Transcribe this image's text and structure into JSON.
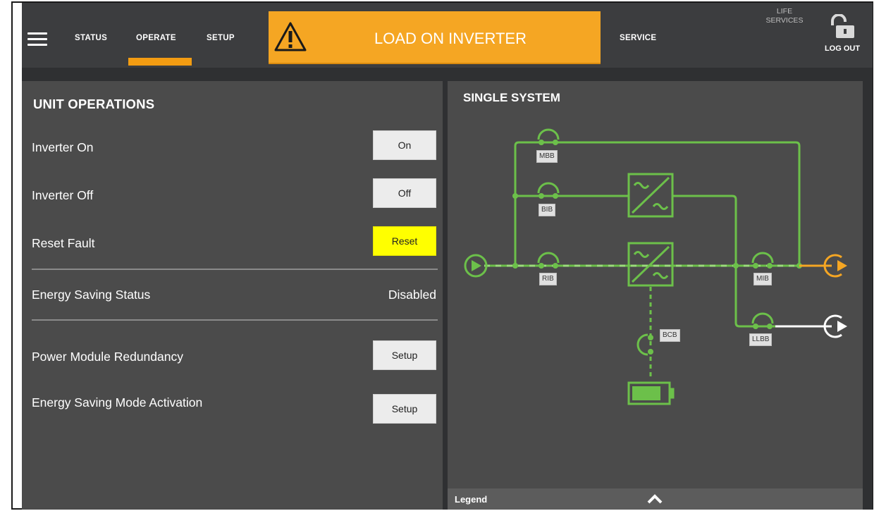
{
  "nav": {
    "tabs": [
      {
        "label": "STATUS"
      },
      {
        "label": "OPERATE"
      },
      {
        "label": "SETUP"
      }
    ],
    "active_tab": "OPERATE",
    "service_label": "SERVICE",
    "life_services_line1": "LIFE",
    "life_services_line2": "SERVICES",
    "logout_label": "LOG OUT"
  },
  "alarm": {
    "text": "LOAD ON INVERTER",
    "icon": "warning-triangle-icon",
    "color": "#f5a623"
  },
  "unit_operations": {
    "title": "UNIT OPERATIONS",
    "rows": [
      {
        "label": "Inverter On",
        "button": "On"
      },
      {
        "label": "Inverter Off",
        "button": "Off"
      },
      {
        "label": "Reset Fault",
        "button": "Reset"
      }
    ],
    "energy_saving_status": {
      "label": "Energy Saving Status",
      "value": "Disabled"
    },
    "setup_rows": [
      {
        "label": "Power Module Redundancy",
        "button": "Setup"
      },
      {
        "label": "Energy Saving Mode Activation",
        "button": "Setup"
      }
    ],
    "reset_color": "#ffff00"
  },
  "single_system": {
    "title": "SINGLE SYSTEM",
    "breakers": {
      "mbb": "MBB",
      "bib": "BIB",
      "rib": "RIB",
      "mib": "MIB",
      "llbb": "LLBB",
      "bcb": "BCB"
    },
    "active_color": "#6cc04a",
    "output_color": "#f5a623",
    "legend_label": "Legend",
    "legend_icon": "chevron-up-icon"
  }
}
